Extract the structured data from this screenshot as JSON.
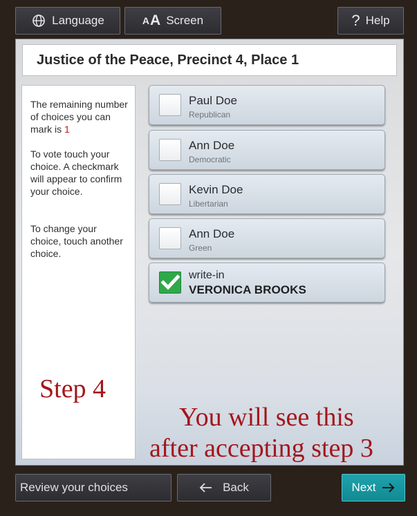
{
  "top_bar": {
    "language_label": "Language",
    "screen_label": "Screen",
    "screen_icon_small": "A",
    "screen_icon_big": "A",
    "help_icon": "?",
    "help_label": "Help"
  },
  "contest": {
    "title": "Justice of the Peace, Precinct 4, Place 1"
  },
  "instructions": {
    "remaining_text": "The remaining number of choices you can mark is ",
    "remaining_count": "1",
    "touch_text": "To vote touch your choice.  A checkmark will appear to confirm your choice.",
    "change_text": "To change your choice, touch another choice."
  },
  "choices": [
    {
      "name": "Paul Doe",
      "party": "Republican",
      "checked": false
    },
    {
      "name": "Ann Doe",
      "party": "Democratic",
      "checked": false
    },
    {
      "name": "Kevin Doe",
      "party": "Libertarian",
      "checked": false
    },
    {
      "name": "Ann Doe",
      "party": "Green",
      "checked": false
    }
  ],
  "write_in": {
    "label": "write-in",
    "name": "VERONICA BROOKS",
    "checked": true
  },
  "annotation": {
    "step": "Step 4",
    "note_line1": "You will see this",
    "note_line2": "after accepting step 3"
  },
  "bottom_bar": {
    "review_label": "Review your choices",
    "back_label": "Back",
    "next_label": "Next"
  },
  "colors": {
    "accent_next": "#1a9aa4",
    "checked_green": "#2fa84a",
    "annotation_red": "#a3161b"
  },
  "icons": {
    "language": "globe-icon",
    "help": "question-icon",
    "back": "arrow-left-icon",
    "next": "arrow-right-icon",
    "check": "checkmark-icon"
  }
}
